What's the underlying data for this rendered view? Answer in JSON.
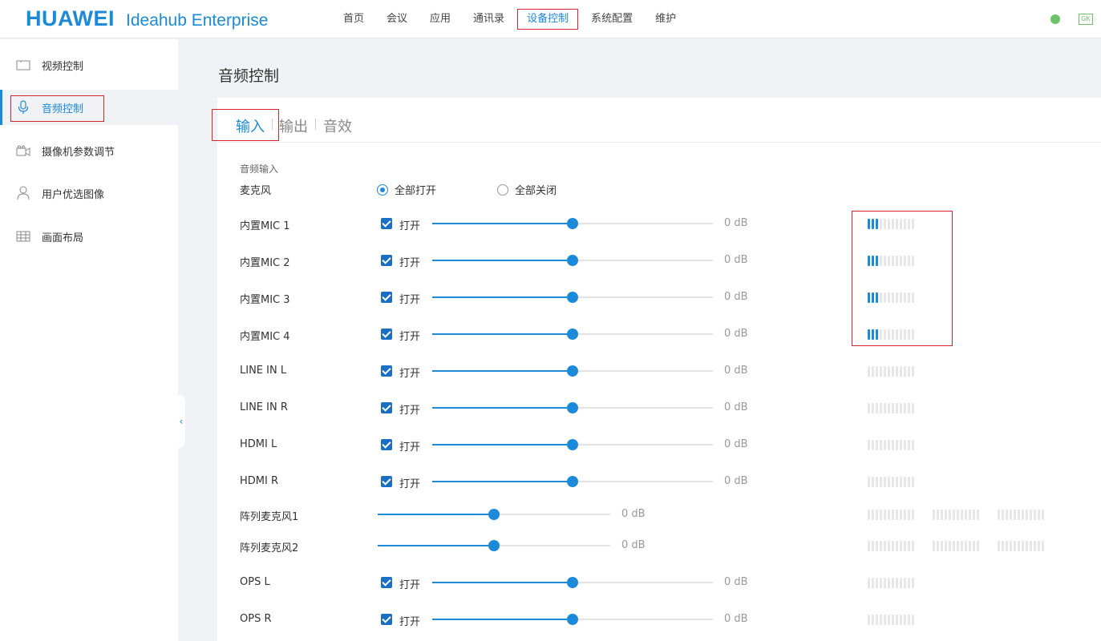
{
  "header": {
    "brand": "HUAWEI",
    "product": "Ideahub Enterprise",
    "nav": [
      {
        "label": "首页",
        "active": false
      },
      {
        "label": "会议",
        "active": false
      },
      {
        "label": "应用",
        "active": false
      },
      {
        "label": "通讯录",
        "active": false
      },
      {
        "label": "设备控制",
        "active": true
      },
      {
        "label": "系统配置",
        "active": false
      },
      {
        "label": "维护",
        "active": false
      }
    ],
    "status_color": "#6cc36c",
    "user_badge": "GK"
  },
  "sidebar": {
    "items": [
      {
        "label": "视频控制",
        "icon": "video-icon",
        "active": false
      },
      {
        "label": "音频控制",
        "icon": "microphone-icon",
        "active": true
      },
      {
        "label": "摄像机参数调节",
        "icon": "camera-icon",
        "active": false
      },
      {
        "label": "用户优选图像",
        "icon": "user-icon",
        "active": false
      },
      {
        "label": "画面布局",
        "icon": "grid-icon",
        "active": false
      }
    ]
  },
  "page": {
    "title": "音频控制",
    "tabs": [
      {
        "label": "输入",
        "active": true
      },
      {
        "label": "输出",
        "active": false
      },
      {
        "label": "音效",
        "active": false
      }
    ],
    "section_label": "音频输入",
    "mic_label": "麦克风",
    "radio_all_on": "全部打开",
    "radio_all_off": "全部关闭",
    "radio_selected": "all_on",
    "channels": [
      {
        "name": "内置MIC 1",
        "enabled": true,
        "toggle_label": "打开",
        "level": 0.5,
        "db": "0 dB",
        "meter_on": 3
      },
      {
        "name": "内置MIC 2",
        "enabled": true,
        "toggle_label": "打开",
        "level": 0.5,
        "db": "0 dB",
        "meter_on": 3
      },
      {
        "name": "内置MIC 3",
        "enabled": true,
        "toggle_label": "打开",
        "level": 0.5,
        "db": "0 dB",
        "meter_on": 3
      },
      {
        "name": "内置MIC 4",
        "enabled": true,
        "toggle_label": "打开",
        "level": 0.5,
        "db": "0 dB",
        "meter_on": 3
      },
      {
        "name": "LINE IN L",
        "enabled": true,
        "toggle_label": "打开",
        "level": 0.5,
        "db": "0 dB",
        "meter_on": 0
      },
      {
        "name": "LINE IN R",
        "enabled": true,
        "toggle_label": "打开",
        "level": 0.5,
        "db": "0 dB",
        "meter_on": 0
      },
      {
        "name": "HDMI L",
        "enabled": true,
        "toggle_label": "打开",
        "level": 0.5,
        "db": "0 dB",
        "meter_on": 0
      },
      {
        "name": "HDMI R",
        "enabled": true,
        "toggle_label": "打开",
        "level": 0.5,
        "db": "0 dB",
        "meter_on": 0
      },
      {
        "name": "阵列麦克风1",
        "array": true,
        "level": 0.5,
        "db": "0 dB",
        "meter_on": 0
      },
      {
        "name": "阵列麦克风2",
        "array": true,
        "level": 0.5,
        "db": "0 dB",
        "meter_on": 0
      },
      {
        "name": "OPS L",
        "enabled": true,
        "toggle_label": "打开",
        "level": 0.5,
        "db": "0 dB",
        "meter_on": 0
      },
      {
        "name": "OPS R",
        "enabled": true,
        "toggle_label": "打开",
        "level": 0.5,
        "db": "0 dB",
        "meter_on": 0
      }
    ]
  }
}
